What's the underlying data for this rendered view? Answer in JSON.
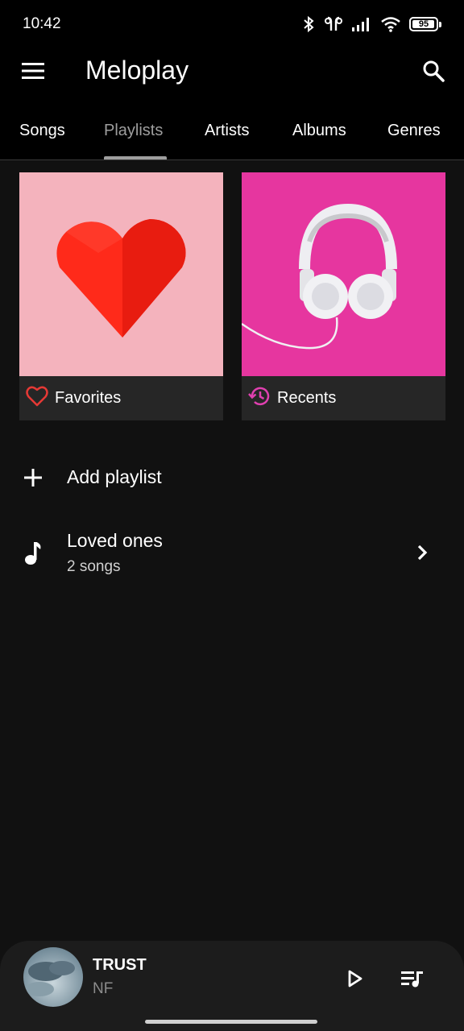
{
  "status_bar": {
    "time": "10:42",
    "icons": [
      "bluetooth-icon",
      "earbuds-icon",
      "signal-icon",
      "wifi-icon",
      "battery-icon"
    ],
    "battery_level": "95",
    "battery_fraction": 0.95
  },
  "app_bar": {
    "title": "Meloplay",
    "menu_icon": "hamburger-menu-icon",
    "search_icon": "search-icon"
  },
  "tabs": {
    "items": [
      {
        "label": "Songs",
        "active": false
      },
      {
        "label": "Playlists",
        "active": true
      },
      {
        "label": "Artists",
        "active": false
      },
      {
        "label": "Albums",
        "active": false
      },
      {
        "label": "Genres",
        "active": false
      }
    ]
  },
  "cards": [
    {
      "label": "Favorites",
      "icon": "heart-outline-icon",
      "icon_color": "#e53935",
      "art": "red-paper-heart-on-pink",
      "bg_color": "#f4b3bd"
    },
    {
      "label": "Recents",
      "icon": "history-icon",
      "icon_color": "#e040b0",
      "art": "white-headphones-on-magenta",
      "bg_color": "#e6369f"
    }
  ],
  "actions": {
    "add_playlist": {
      "label": "Add playlist",
      "icon": "plus-icon"
    }
  },
  "playlists": [
    {
      "title": "Loved ones",
      "subtitle": "2 songs",
      "icon": "music-note-icon",
      "trailing_icon": "chevron-right-icon"
    }
  ],
  "mini_player": {
    "title": "TRUST",
    "artist": "NF",
    "art": "cloudy-sky-album-art",
    "play_icon": "play-icon",
    "queue_icon": "queue-music-icon"
  },
  "colors": {
    "background": "#111111",
    "top_bar": "#000000",
    "card_footer": "#262626",
    "tab_active": "#9e9e9e",
    "mini_player": "#1c1c1c"
  }
}
